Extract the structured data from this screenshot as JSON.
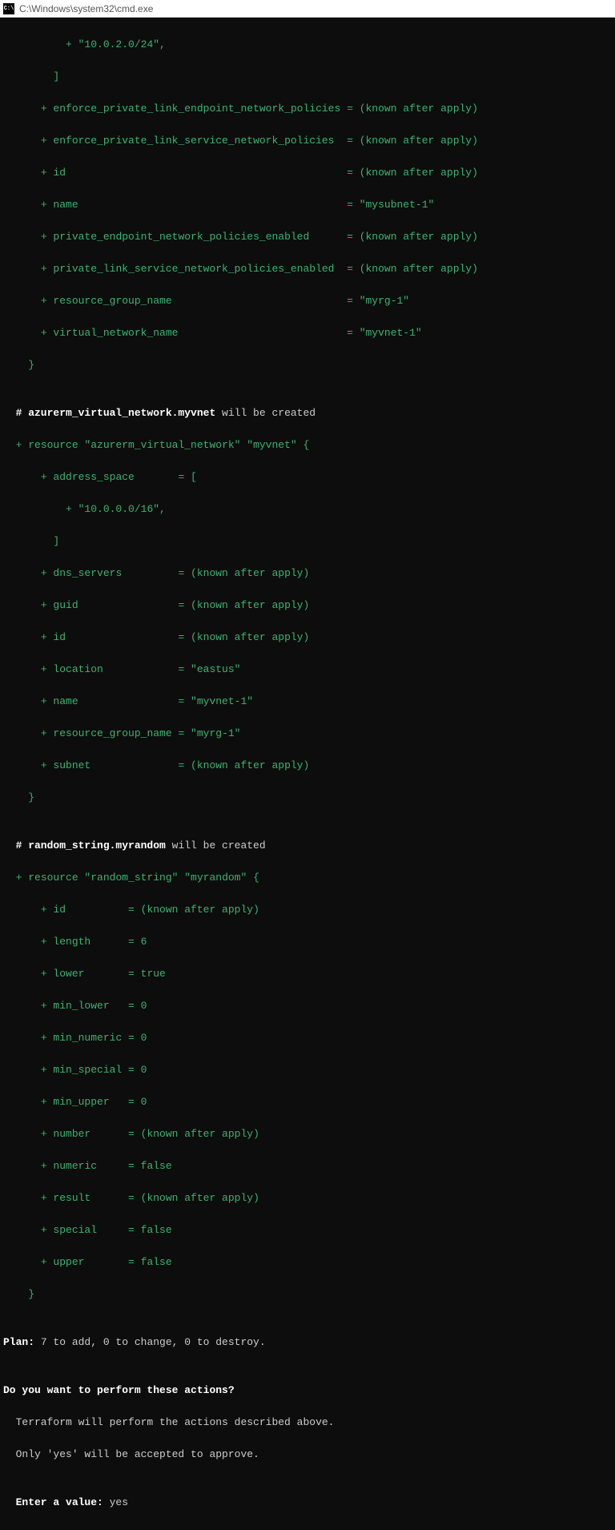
{
  "window": {
    "icon_text": "C:\\",
    "title": "C:\\Windows\\system32\\cmd.exe"
  },
  "lines": {
    "l1a": "          ",
    "l1b": "+",
    "l1c": " \"10.0.2.0/24\",",
    "l2": "        ]",
    "l3a": "      ",
    "l3b": "+",
    "l3c": " enforce_private_link_endpoint_network_policies = (known after apply)",
    "l4a": "      ",
    "l4b": "+",
    "l4c": " enforce_private_link_service_network_policies  = (known after apply)",
    "l5a": "      ",
    "l5b": "+",
    "l5c": " id                                             = (known after apply)",
    "l6a": "      ",
    "l6b": "+",
    "l6c": " name                                           = \"mysubnet-1\"",
    "l7a": "      ",
    "l7b": "+",
    "l7c": " private_endpoint_network_policies_enabled      = (known after apply)",
    "l8a": "      ",
    "l8b": "+",
    "l8c": " private_link_service_network_policies_enabled  = (known after apply)",
    "l9a": "      ",
    "l9b": "+",
    "l9c": " resource_group_name                            = \"myrg-1\"",
    "l10a": "      ",
    "l10b": "+",
    "l10c": " virtual_network_name                           = \"myvnet-1\"",
    "l11": "    }",
    "l12": "",
    "l13a": "  # azurerm_virtual_network.myvnet",
    "l13b": " will be created",
    "l14a": "  ",
    "l14b": "+",
    "l14c": " resource \"azurerm_virtual_network\" \"myvnet\" {",
    "l15a": "      ",
    "l15b": "+",
    "l15c": " address_space       = [",
    "l16a": "          ",
    "l16b": "+",
    "l16c": " \"10.0.0.0/16\",",
    "l17": "        ]",
    "l18a": "      ",
    "l18b": "+",
    "l18c": " dns_servers         = (known after apply)",
    "l19a": "      ",
    "l19b": "+",
    "l19c": " guid                = (known after apply)",
    "l20a": "      ",
    "l20b": "+",
    "l20c": " id                  = (known after apply)",
    "l21a": "      ",
    "l21b": "+",
    "l21c": " location            = \"eastus\"",
    "l22a": "      ",
    "l22b": "+",
    "l22c": " name                = \"myvnet-1\"",
    "l23a": "      ",
    "l23b": "+",
    "l23c": " resource_group_name = \"myrg-1\"",
    "l24a": "      ",
    "l24b": "+",
    "l24c": " subnet              = (known after apply)",
    "l25": "    }",
    "l26": "",
    "l27a": "  # random_string.myrandom",
    "l27b": " will be created",
    "l28a": "  ",
    "l28b": "+",
    "l28c": " resource \"random_string\" \"myrandom\" {",
    "l29a": "      ",
    "l29b": "+",
    "l29c": " id          = (known after apply)",
    "l30a": "      ",
    "l30b": "+",
    "l30c": " length      = 6",
    "l31a": "      ",
    "l31b": "+",
    "l31c": " lower       = true",
    "l32a": "      ",
    "l32b": "+",
    "l32c": " min_lower   = 0",
    "l33a": "      ",
    "l33b": "+",
    "l33c": " min_numeric = 0",
    "l34a": "      ",
    "l34b": "+",
    "l34c": " min_special = 0",
    "l35a": "      ",
    "l35b": "+",
    "l35c": " min_upper   = 0",
    "l36a": "      ",
    "l36b": "+",
    "l36c": " number      = (known after apply)",
    "l37a": "      ",
    "l37b": "+",
    "l37c": " numeric     = false",
    "l38a": "      ",
    "l38b": "+",
    "l38c": " result      = (known after apply)",
    "l39a": "      ",
    "l39b": "+",
    "l39c": " special     = false",
    "l40a": "      ",
    "l40b": "+",
    "l40c": " upper       = false",
    "l41": "    }",
    "l42": "",
    "l43a": "Plan:",
    "l43b": " 7 to add, 0 to change, 0 to destroy.",
    "l44": "",
    "l45": "Do you want to perform these actions?",
    "l46": "  Terraform will perform the actions described above.",
    "l47": "  Only 'yes' will be accepted to approve.",
    "l48": "",
    "l49a": "  Enter a value:",
    "l49b": " yes"
  }
}
